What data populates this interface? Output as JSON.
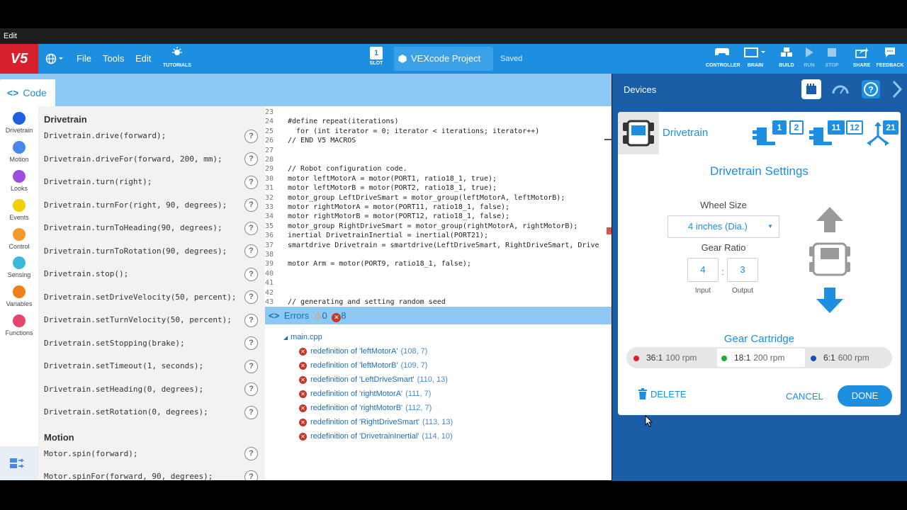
{
  "os_menu": {
    "edit": "Edit"
  },
  "header": {
    "logo": "V5",
    "file": "File",
    "tools": "Tools",
    "edit": "Edit",
    "tutorials": "TUTORIALS",
    "slot_number": "1",
    "slot": "SLOT",
    "project_name": "VEXcode Project",
    "saved": "Saved",
    "controller": "CONTROLLER",
    "brain": "BRAIN",
    "build": "BUILD",
    "run": "RUN",
    "stop": "STOP",
    "share": "SHARE",
    "feedback": "FEEDBACK",
    "brand_color": "#1e8ee0"
  },
  "code_tab": {
    "label": "Code"
  },
  "categories": [
    {
      "name": "Drivetrain",
      "color": "#1f5fe0"
    },
    {
      "name": "Motion",
      "color": "#4a86e8"
    },
    {
      "name": "Looks",
      "color": "#9b4fe0"
    },
    {
      "name": "Events",
      "color": "#f0d000"
    },
    {
      "name": "Control",
      "color": "#f39a2b"
    },
    {
      "name": "Sensing",
      "color": "#3cb8d8"
    },
    {
      "name": "Variables",
      "color": "#f07f1a"
    },
    {
      "name": "Functions",
      "color": "#e8446a"
    }
  ],
  "palette": {
    "drivetrain_heading": "Drivetrain",
    "drivetrain_items": [
      "Drivetrain.drive(forward);",
      "Drivetrain.driveFor(forward, 200, mm);",
      "Drivetrain.turn(right);",
      "Drivetrain.turnFor(right, 90, degrees);",
      "Drivetrain.turnToHeading(90, degrees);",
      "Drivetrain.turnToRotation(90, degrees);",
      "Drivetrain.stop();",
      "Drivetrain.setDriveVelocity(50, percent);",
      "Drivetrain.setTurnVelocity(50, percent);",
      "Drivetrain.setStopping(brake);",
      "Drivetrain.setTimeout(1, seconds);",
      "Drivetrain.setHeading(0, degrees);",
      "Drivetrain.setRotation(0, degrees);"
    ],
    "motion_heading": "Motion",
    "motion_items": [
      "Motor.spin(forward);",
      "Motor.spinFor(forward, 90, degrees);"
    ],
    "help": "?"
  },
  "editor": {
    "lines": [
      {
        "n": "23",
        "t": ""
      },
      {
        "n": "24",
        "t": "#define repeat(iterations)"
      },
      {
        "n": "25",
        "t": "  for (int iterator = 0; iterator < iterations; iterator++)"
      },
      {
        "n": "26",
        "t": "// END V5 MACROS"
      },
      {
        "n": "27",
        "t": ""
      },
      {
        "n": "28",
        "t": ""
      },
      {
        "n": "29",
        "t": "// Robot configuration code."
      },
      {
        "n": "30",
        "t": "motor leftMotorA = motor(PORT1, ratio18_1, true);"
      },
      {
        "n": "31",
        "t": "motor leftMotorB = motor(PORT2, ratio18_1, true);"
      },
      {
        "n": "32",
        "t": "motor_group LeftDriveSmart = motor_group(leftMotorA, leftMotorB);"
      },
      {
        "n": "33",
        "t": "motor rightMotorA = motor(PORT11, ratio18_1, false);"
      },
      {
        "n": "34",
        "t": "motor rightMotorB = motor(PORT12, ratio18_1, false);"
      },
      {
        "n": "35",
        "t": "motor_group RightDriveSmart = motor_group(rightMotorA, rightMotorB);"
      },
      {
        "n": "36",
        "t": "inertial DrivetrainInertial = inertial(PORT21);"
      },
      {
        "n": "37",
        "t": "smartdrive Drivetrain = smartdrive(LeftDriveSmart, RightDriveSmart, Drive"
      },
      {
        "n": "38",
        "t": ""
      },
      {
        "n": "39",
        "t": "motor Arm = motor(PORT9, ratio18_1, false);"
      },
      {
        "n": "40",
        "t": ""
      },
      {
        "n": "41",
        "t": ""
      },
      {
        "n": "42",
        "t": ""
      },
      {
        "n": "43",
        "t": "// generating and setting random seed"
      }
    ]
  },
  "errors": {
    "label": "Errors",
    "warnings": "0",
    "errors": "8",
    "file": "main.cpp",
    "items": [
      {
        "msg": "redefinition of 'leftMotorA'",
        "pos": "(108, 7)"
      },
      {
        "msg": "redefinition of 'leftMotorB'",
        "pos": "(109, 7)"
      },
      {
        "msg": "redefinition of 'LeftDriveSmart'",
        "pos": "(110, 13)"
      },
      {
        "msg": "redefinition of 'rightMotorA'",
        "pos": "(111, 7)"
      },
      {
        "msg": "redefinition of 'rightMotorB'",
        "pos": "(112, 7)"
      },
      {
        "msg": "redefinition of 'RightDriveSmart'",
        "pos": "(113, 13)"
      },
      {
        "msg": "redefinition of 'DrivetrainInertial'",
        "pos": "(114, 10)"
      }
    ]
  },
  "devices": {
    "title": "Devices",
    "drivetrain_name": "Drivetrain",
    "ports": [
      "1",
      "2",
      "11",
      "12",
      "21"
    ],
    "settings_title": "Drivetrain Settings",
    "wheel_size_label": "Wheel Size",
    "wheel_size_value": "4 inches (Dia.)",
    "gear_ratio_label": "Gear Ratio",
    "gear_input": "4",
    "gear_output": "3",
    "colon": ":",
    "input_label": "Input",
    "output_label": "Output",
    "cartridge_title": "Gear Cartridge",
    "cartridges": [
      {
        "ratio": "36:1",
        "rpm": "100 rpm",
        "color": "#e02020"
      },
      {
        "ratio": "18:1",
        "rpm": "200 rpm",
        "color": "#22aa33"
      },
      {
        "ratio": "6:1",
        "rpm": "600 rpm",
        "color": "#1a4fb0"
      }
    ],
    "delete": "DELETE",
    "cancel": "CANCEL",
    "done": "DONE"
  }
}
